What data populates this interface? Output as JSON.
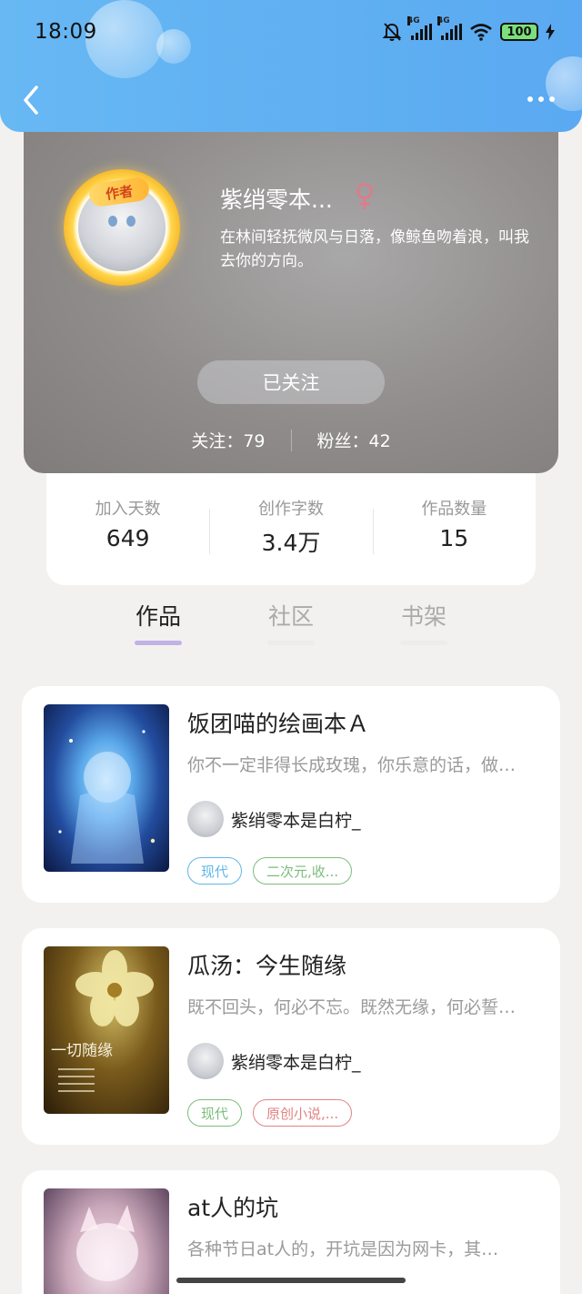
{
  "status_bar": {
    "time": "18:09",
    "battery": "100",
    "network": "4G"
  },
  "header": {
    "back_icon": "back-arrow-icon",
    "more_icon": "more-dots-icon"
  },
  "profile": {
    "author_badge": "作者",
    "nickname": "紫绡零本...",
    "gender_icon": "female-icon",
    "bio": "在林间轻抚微风与日落，像鲸鱼吻着浪，叫我去你的方向。",
    "follow_button": "已关注",
    "following_label": "关注：79",
    "followers_label": "粉丝：42"
  },
  "stats": [
    {
      "label": "加入天数",
      "value": "649"
    },
    {
      "label": "创作字数",
      "value": "3.4万"
    },
    {
      "label": "作品数量",
      "value": "15"
    }
  ],
  "tabs": [
    {
      "label": "作品",
      "active": true
    },
    {
      "label": "社区",
      "active": false
    },
    {
      "label": "书架",
      "active": false
    }
  ],
  "works": [
    {
      "title": "饭团喵的绘画本Ａ",
      "desc": "你不一定非得长成玫瑰，你乐意的话，做…",
      "author": "紫绡零本是白柠_",
      "tags": [
        {
          "label": "现代",
          "color": "#5fb6e6"
        },
        {
          "label": "二次元,收...",
          "color": "#7bbd7b"
        }
      ]
    },
    {
      "title": "瓜汤：今生随缘",
      "desc": "既不回头，何必不忘。既然无缘，何必誓…",
      "author": "紫绡零本是白柠_",
      "tags": [
        {
          "label": "现代",
          "color": "#7bbd7b"
        },
        {
          "label": "原创小说,...",
          "color": "#e08484"
        }
      ],
      "cover_text": "一切随缘"
    },
    {
      "title": "at人的坑",
      "desc": "各种节日at人的，开坑是因为网卡，其…"
    }
  ]
}
